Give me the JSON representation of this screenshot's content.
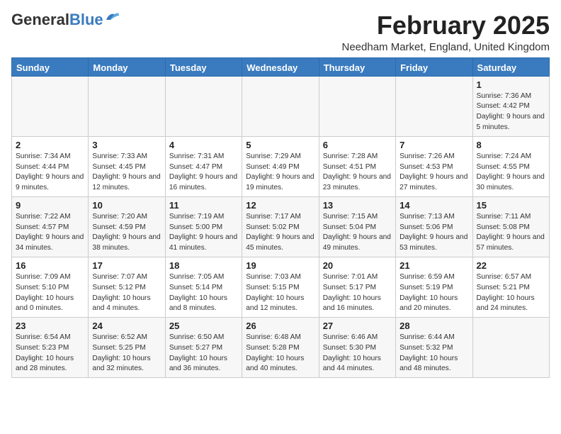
{
  "header": {
    "logo_general": "General",
    "logo_blue": "Blue",
    "month_title": "February 2025",
    "location": "Needham Market, England, United Kingdom"
  },
  "weekdays": [
    "Sunday",
    "Monday",
    "Tuesday",
    "Wednesday",
    "Thursday",
    "Friday",
    "Saturday"
  ],
  "weeks": [
    [
      {
        "day": "",
        "info": ""
      },
      {
        "day": "",
        "info": ""
      },
      {
        "day": "",
        "info": ""
      },
      {
        "day": "",
        "info": ""
      },
      {
        "day": "",
        "info": ""
      },
      {
        "day": "",
        "info": ""
      },
      {
        "day": "1",
        "info": "Sunrise: 7:36 AM\nSunset: 4:42 PM\nDaylight: 9 hours and 5 minutes."
      }
    ],
    [
      {
        "day": "2",
        "info": "Sunrise: 7:34 AM\nSunset: 4:44 PM\nDaylight: 9 hours and 9 minutes."
      },
      {
        "day": "3",
        "info": "Sunrise: 7:33 AM\nSunset: 4:45 PM\nDaylight: 9 hours and 12 minutes."
      },
      {
        "day": "4",
        "info": "Sunrise: 7:31 AM\nSunset: 4:47 PM\nDaylight: 9 hours and 16 minutes."
      },
      {
        "day": "5",
        "info": "Sunrise: 7:29 AM\nSunset: 4:49 PM\nDaylight: 9 hours and 19 minutes."
      },
      {
        "day": "6",
        "info": "Sunrise: 7:28 AM\nSunset: 4:51 PM\nDaylight: 9 hours and 23 minutes."
      },
      {
        "day": "7",
        "info": "Sunrise: 7:26 AM\nSunset: 4:53 PM\nDaylight: 9 hours and 27 minutes."
      },
      {
        "day": "8",
        "info": "Sunrise: 7:24 AM\nSunset: 4:55 PM\nDaylight: 9 hours and 30 minutes."
      }
    ],
    [
      {
        "day": "9",
        "info": "Sunrise: 7:22 AM\nSunset: 4:57 PM\nDaylight: 9 hours and 34 minutes."
      },
      {
        "day": "10",
        "info": "Sunrise: 7:20 AM\nSunset: 4:59 PM\nDaylight: 9 hours and 38 minutes."
      },
      {
        "day": "11",
        "info": "Sunrise: 7:19 AM\nSunset: 5:00 PM\nDaylight: 9 hours and 41 minutes."
      },
      {
        "day": "12",
        "info": "Sunrise: 7:17 AM\nSunset: 5:02 PM\nDaylight: 9 hours and 45 minutes."
      },
      {
        "day": "13",
        "info": "Sunrise: 7:15 AM\nSunset: 5:04 PM\nDaylight: 9 hours and 49 minutes."
      },
      {
        "day": "14",
        "info": "Sunrise: 7:13 AM\nSunset: 5:06 PM\nDaylight: 9 hours and 53 minutes."
      },
      {
        "day": "15",
        "info": "Sunrise: 7:11 AM\nSunset: 5:08 PM\nDaylight: 9 hours and 57 minutes."
      }
    ],
    [
      {
        "day": "16",
        "info": "Sunrise: 7:09 AM\nSunset: 5:10 PM\nDaylight: 10 hours and 0 minutes."
      },
      {
        "day": "17",
        "info": "Sunrise: 7:07 AM\nSunset: 5:12 PM\nDaylight: 10 hours and 4 minutes."
      },
      {
        "day": "18",
        "info": "Sunrise: 7:05 AM\nSunset: 5:14 PM\nDaylight: 10 hours and 8 minutes."
      },
      {
        "day": "19",
        "info": "Sunrise: 7:03 AM\nSunset: 5:15 PM\nDaylight: 10 hours and 12 minutes."
      },
      {
        "day": "20",
        "info": "Sunrise: 7:01 AM\nSunset: 5:17 PM\nDaylight: 10 hours and 16 minutes."
      },
      {
        "day": "21",
        "info": "Sunrise: 6:59 AM\nSunset: 5:19 PM\nDaylight: 10 hours and 20 minutes."
      },
      {
        "day": "22",
        "info": "Sunrise: 6:57 AM\nSunset: 5:21 PM\nDaylight: 10 hours and 24 minutes."
      }
    ],
    [
      {
        "day": "23",
        "info": "Sunrise: 6:54 AM\nSunset: 5:23 PM\nDaylight: 10 hours and 28 minutes."
      },
      {
        "day": "24",
        "info": "Sunrise: 6:52 AM\nSunset: 5:25 PM\nDaylight: 10 hours and 32 minutes."
      },
      {
        "day": "25",
        "info": "Sunrise: 6:50 AM\nSunset: 5:27 PM\nDaylight: 10 hours and 36 minutes."
      },
      {
        "day": "26",
        "info": "Sunrise: 6:48 AM\nSunset: 5:28 PM\nDaylight: 10 hours and 40 minutes."
      },
      {
        "day": "27",
        "info": "Sunrise: 6:46 AM\nSunset: 5:30 PM\nDaylight: 10 hours and 44 minutes."
      },
      {
        "day": "28",
        "info": "Sunrise: 6:44 AM\nSunset: 5:32 PM\nDaylight: 10 hours and 48 minutes."
      },
      {
        "day": "",
        "info": ""
      }
    ]
  ]
}
